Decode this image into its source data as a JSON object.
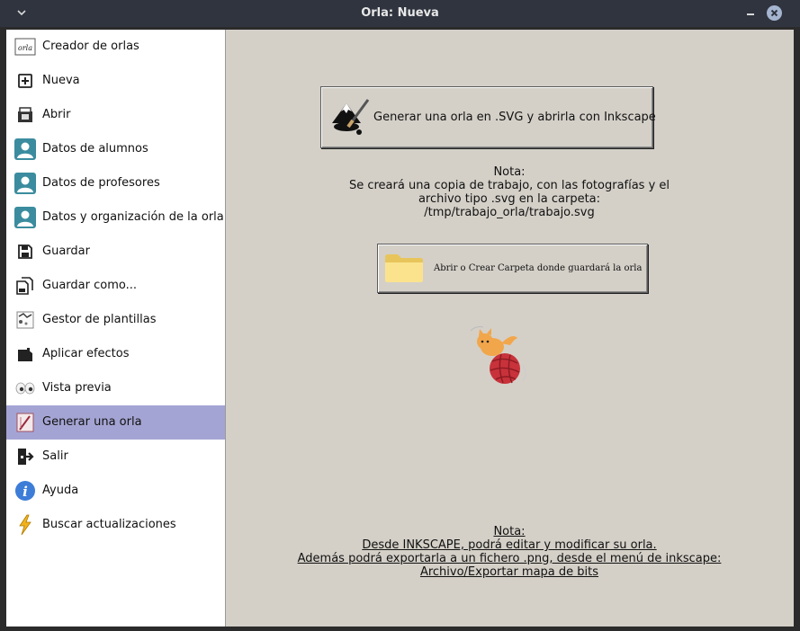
{
  "window": {
    "title": "Orla: Nueva"
  },
  "sidebar": {
    "items": [
      {
        "label": "Creador de orlas",
        "icon": "orla-logo-icon"
      },
      {
        "label": "Nueva",
        "icon": "new-file-icon"
      },
      {
        "label": "Abrir",
        "icon": "open-icon"
      },
      {
        "label": "Datos de alumnos",
        "icon": "user-icon"
      },
      {
        "label": "Datos de profesores",
        "icon": "user-icon"
      },
      {
        "label": "Datos y organización de la orla",
        "icon": "user-icon"
      },
      {
        "label": "Guardar",
        "icon": "save-icon"
      },
      {
        "label": "Guardar como...",
        "icon": "save-as-icon"
      },
      {
        "label": "Gestor de plantillas",
        "icon": "template-icon"
      },
      {
        "label": "Aplicar efectos",
        "icon": "effects-icon"
      },
      {
        "label": "Vista previa",
        "icon": "eyes-icon"
      },
      {
        "label": "Generar una orla",
        "icon": "generate-icon"
      },
      {
        "label": "Salir",
        "icon": "exit-icon"
      },
      {
        "label": "Ayuda",
        "icon": "info-icon"
      },
      {
        "label": "Buscar actualizaciones",
        "icon": "lightning-icon"
      }
    ],
    "active_index": 11,
    "active_color": "#a4a4d4"
  },
  "main": {
    "inkscape_button": {
      "label": "Generar una orla en .SVG y abrirla con Inkscape",
      "icon": "inkscape-icon"
    },
    "note_top": {
      "line1": "Nota:",
      "line2": "Se creará una copia de trabajo, con las fotografías y el",
      "line3": "archivo tipo .svg en la carpeta:",
      "line4": "/tmp/trabajo_orla/trabajo.svg"
    },
    "folder_button": {
      "label": "Abrir o Crear Carpeta donde guardará la orla",
      "icon": "folder-icon"
    },
    "note_bottom": {
      "line1": "Nota:",
      "line2": "Desde INKSCAPE, podrá editar y modificar su orla.",
      "line3": "Además podrá exportarla a un fichero .png, desde el menú de inkscape:",
      "line4": "Archivo/Exportar mapa de bits"
    },
    "background": "#d4d0c8"
  }
}
